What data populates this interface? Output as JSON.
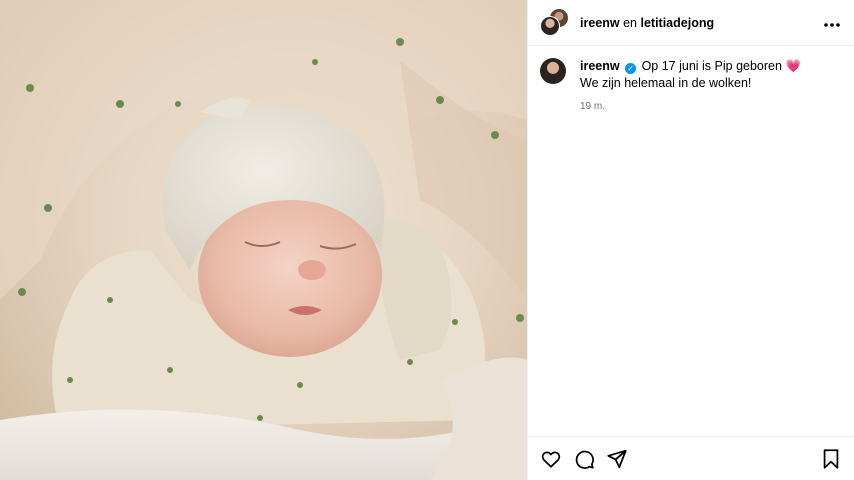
{
  "header": {
    "user1": "ireenw",
    "conjunction": "en",
    "user2": "letitiadejong"
  },
  "caption": {
    "username": "ireenw",
    "line1": "Op 17 juni is Pip geboren",
    "emoji": "💗",
    "line2": "We zijn helemaal in de wolken!",
    "time": "19 m."
  },
  "photo": {
    "alt": "Sleeping newborn baby in knit hat"
  },
  "icons": {
    "more": "more-options-icon",
    "like": "heart-icon",
    "comment": "comment-icon",
    "share": "share-icon",
    "save": "bookmark-icon"
  },
  "colors": {
    "verified": "#0095f6",
    "heart_emoji": "#e8419b"
  }
}
